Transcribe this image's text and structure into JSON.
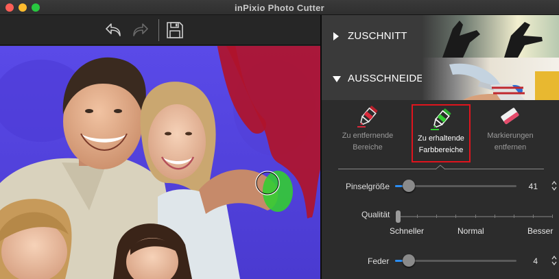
{
  "window": {
    "title": "inPixio Photo Cutter"
  },
  "toolbar": {
    "undo_icon": "undo-arrow-icon",
    "redo_icon": "redo-arrow-icon",
    "save_icon": "floppy-disk-icon"
  },
  "sections": [
    {
      "label": "ZUSCHNITT",
      "expanded": false
    },
    {
      "label": "AUSSCHNEIDEN",
      "expanded": true
    }
  ],
  "tools": [
    {
      "line1": "Zu entfernende",
      "line2": "Bereiche",
      "icon": "red-marker-icon",
      "active": false
    },
    {
      "line1": "Zu erhaltende",
      "line2": "Farbbereiche",
      "icon": "green-marker-icon",
      "active": true
    },
    {
      "line1": "Markierungen",
      "line2": "entfernen",
      "icon": "eraser-icon",
      "active": false
    }
  ],
  "brush_size": {
    "label": "Pinselgröße",
    "value": "41",
    "fraction": 0.06
  },
  "quality": {
    "label": "Qualität",
    "fraction": 0.0,
    "labels": [
      "Schneller",
      "Normal",
      "Besser"
    ]
  },
  "feather": {
    "label": "Feder",
    "value": "4",
    "fraction": 0.06
  },
  "colors": {
    "accent": "#2a8ef5",
    "active_border": "#e0141d",
    "keep_mark": "#33cc33",
    "remove_mark": "#b0142b",
    "background_overlay": "#5a43e0"
  }
}
